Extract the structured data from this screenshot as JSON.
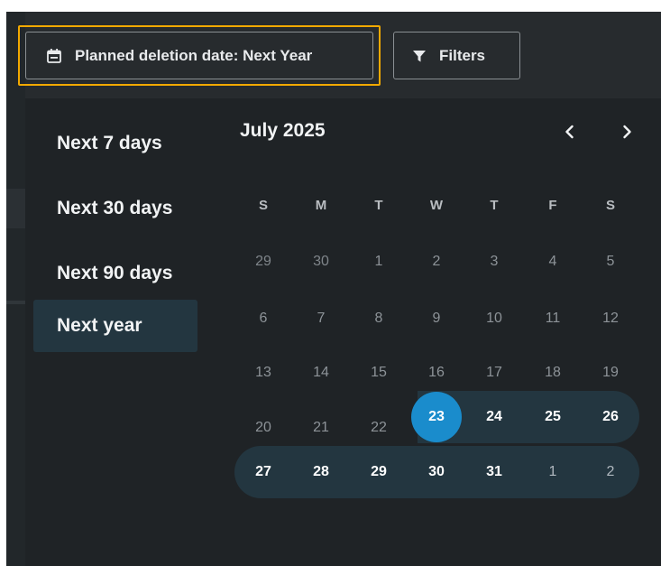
{
  "toolbar": {
    "date_filter_label": "Planned deletion date: Next Year",
    "filters_label": "Filters"
  },
  "presets": [
    {
      "label": "Next 7 days",
      "active": false
    },
    {
      "label": "Next 30 days",
      "active": false
    },
    {
      "label": "Next 90 days",
      "active": false
    },
    {
      "label": "Next year",
      "active": true
    }
  ],
  "calendar": {
    "month_label": "July 2025",
    "weekdays": [
      "S",
      "M",
      "T",
      "W",
      "T",
      "F",
      "S"
    ],
    "weeks": [
      [
        "29",
        "30",
        "1",
        "2",
        "3",
        "4",
        "5"
      ],
      [
        "6",
        "7",
        "8",
        "9",
        "10",
        "11",
        "12"
      ],
      [
        "13",
        "14",
        "15",
        "16",
        "17",
        "18",
        "19"
      ],
      [
        "20",
        "21",
        "22",
        "23",
        "24",
        "25",
        "26"
      ],
      [
        "27",
        "28",
        "29",
        "30",
        "31",
        "1",
        "2"
      ]
    ],
    "selected_day": "23"
  },
  "colors": {
    "accent": "#1a8ccc",
    "focus_ring": "#f2a900",
    "range_fill": "#233640"
  },
  "icons": {
    "date_filter": "calendar-icon",
    "filters": "funnel-icon",
    "prev_month": "chevron-left-icon",
    "next_month": "chevron-right-icon"
  }
}
